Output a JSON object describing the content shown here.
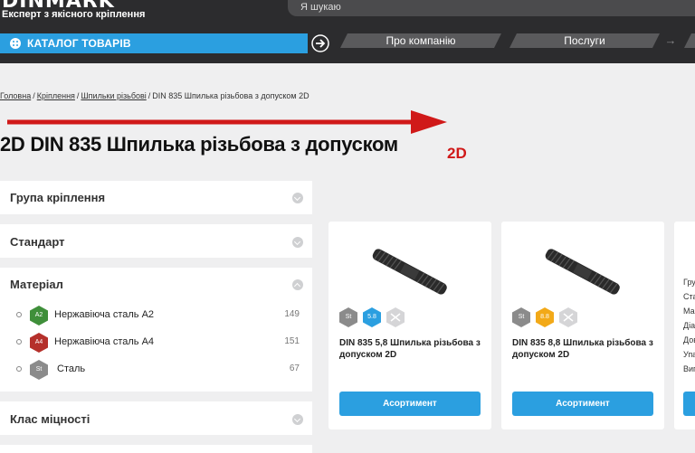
{
  "header": {
    "logo": "DINMARK",
    "tagline": "Експерт з якісного кріплення",
    "search_placeholder": "Я шукаю",
    "catalog_label": "КАТАЛОГ ТОВАРІВ",
    "nav": {
      "about": "Про компанію",
      "services": "Послуги",
      "more": "→"
    }
  },
  "breadcrumb": {
    "items": [
      "Головна",
      "Кріплення",
      "Шпильки різьбові"
    ],
    "current": "DIN 835 Шпилька різьбова з допуском 2D",
    "separator": "/"
  },
  "page_title": "2D DIN 835 Шпилька різьбова з допуском",
  "annotation_label": "2D",
  "sidebar": {
    "filters": [
      {
        "title": "Група кріплення"
      },
      {
        "title": "Стандарт"
      },
      {
        "title": "Матеріал"
      },
      {
        "title": "Клас міцності"
      }
    ],
    "materials": [
      {
        "badge": "A2",
        "label": "Нержавіюча сталь A2",
        "count": "149",
        "color": "#3f8f3a"
      },
      {
        "badge": "A4",
        "label": "Нержавіюча сталь A4",
        "count": "151",
        "color": "#b5302b"
      },
      {
        "badge": "St",
        "label": "Сталь",
        "count": "67",
        "color": "#8b8b8b"
      }
    ]
  },
  "products": [
    {
      "name": "DIN 835 5,8 Шпилька різьбова з допуском 2D",
      "button": "Асортимент",
      "badges": [
        {
          "text": "St",
          "color": "#8b8b8b"
        },
        {
          "text": "5.8",
          "color": "#2b9fe0"
        },
        {
          "text": "",
          "color": "#d5d5d7"
        }
      ]
    },
    {
      "name": "DIN 835 8,8 Шпилька різьбова з допуском 2D",
      "button": "Асортимент",
      "badges": [
        {
          "text": "St",
          "color": "#8b8b8b"
        },
        {
          "text": "8.8",
          "color": "#f2a918"
        },
        {
          "text": "",
          "color": "#d5d5d7"
        }
      ]
    }
  ],
  "partial_card": {
    "lines": [
      "Гру",
      "Ста",
      "Ма",
      "Діа",
      "Дов",
      "Упа",
      "Виг"
    ]
  },
  "colors": {
    "accent": "#2b9fe0",
    "header": "#2c2c2e",
    "annotation": "#d01919"
  }
}
